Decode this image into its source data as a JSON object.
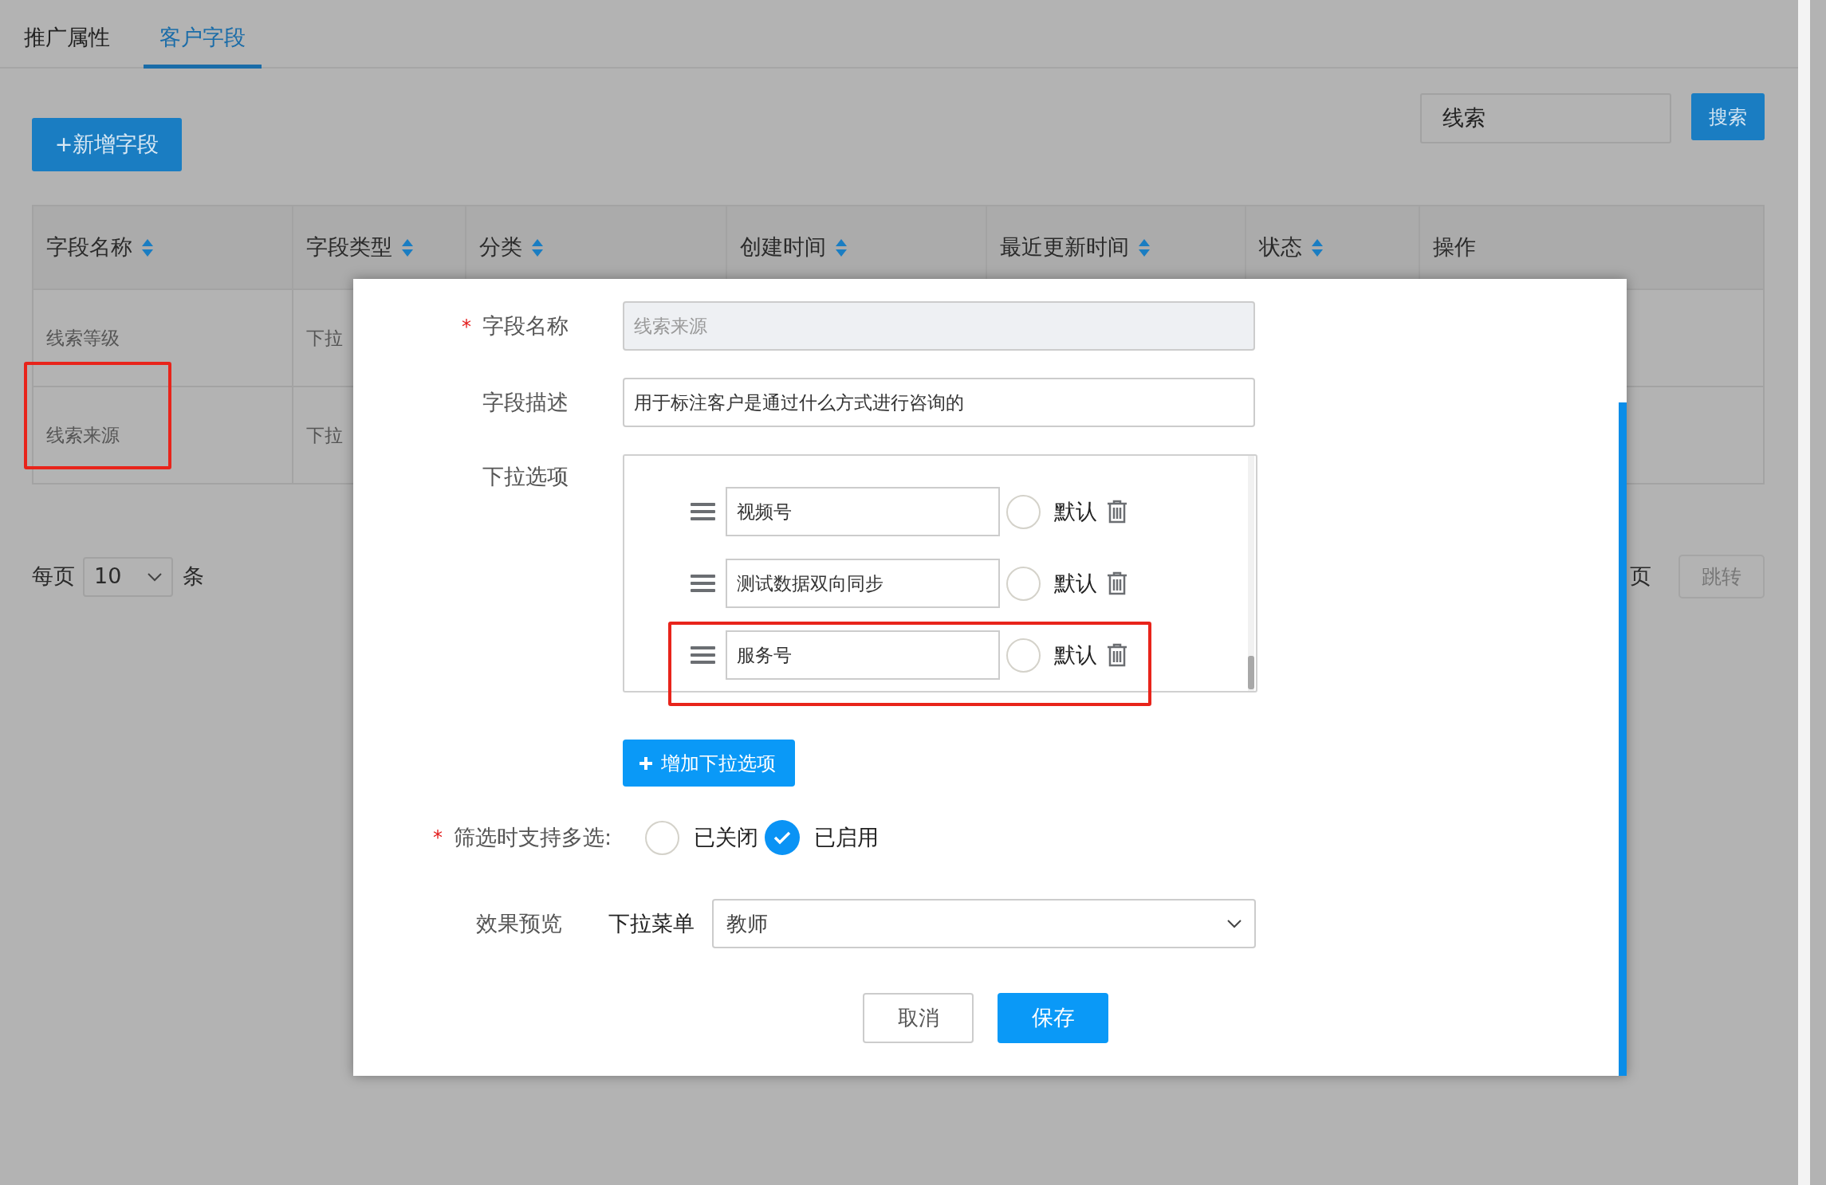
{
  "tabs": [
    {
      "label": "推广属性",
      "selected": false
    },
    {
      "label": "客户字段",
      "selected": true
    }
  ],
  "add_button": "+新增字段",
  "search": {
    "value": "线索",
    "button": "搜索"
  },
  "table": {
    "columns": [
      {
        "label": "字段名称",
        "sortable": true
      },
      {
        "label": "字段类型",
        "sortable": true
      },
      {
        "label": "分类",
        "sortable": true
      },
      {
        "label": "创建时间",
        "sortable": true
      },
      {
        "label": "最近更新时间",
        "sortable": true
      },
      {
        "label": "状态",
        "sortable": true
      },
      {
        "label": "操作",
        "sortable": false
      }
    ],
    "rows": [
      {
        "cells": [
          "线索等级",
          "下拉"
        ],
        "highlighted": false
      },
      {
        "cells": [
          "线索来源",
          "下拉"
        ],
        "highlighted": true
      }
    ]
  },
  "pagination": {
    "per_page_label": "每页",
    "page_size": "10",
    "unit": "条",
    "page_suffix": "页",
    "jump_button": "跳转"
  },
  "modal": {
    "name_field": {
      "label": "字段名称",
      "required_mark": "*",
      "value": "线索来源",
      "disabled": true
    },
    "desc_field": {
      "label": "字段描述",
      "value": "用于标注客户是通过什么方式进行咨询的",
      "disabled": false
    },
    "options_label": "下拉选项",
    "options": [
      {
        "value": "视频号",
        "default": false,
        "default_label": "默认",
        "highlighted": false
      },
      {
        "value": "测试数据双向同步",
        "default": false,
        "default_label": "默认",
        "highlighted": false
      },
      {
        "value": "服务号",
        "default": false,
        "default_label": "默认",
        "highlighted": true
      }
    ],
    "add_option_button": "增加下拉选项",
    "multi": {
      "label": "筛选时支持多选:",
      "required_mark": "*",
      "choices": [
        {
          "label": "已关闭",
          "selected": false
        },
        {
          "label": "已启用",
          "selected": true
        }
      ]
    },
    "preview": {
      "label": "效果预览",
      "select_label": "下拉菜单",
      "value": "教师"
    },
    "cancel_button": "取消",
    "save_button": "保存"
  }
}
